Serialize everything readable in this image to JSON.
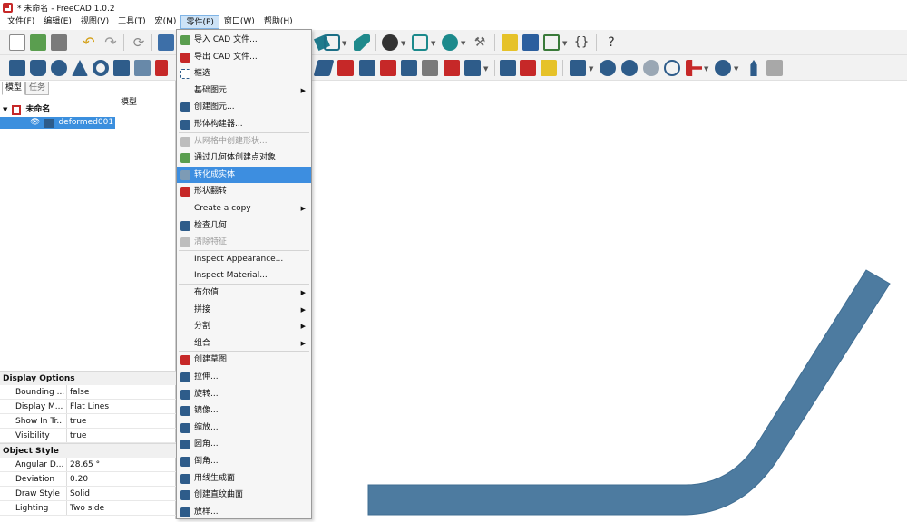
{
  "window": {
    "title": "* 未命名 - FreeCAD 1.0.2"
  },
  "menubar": {
    "items": [
      "文件(F)",
      "编辑(E)",
      "视图(V)",
      "工具(T)",
      "宏(M)",
      "零件(P)",
      "窗口(W)",
      "帮助(H)"
    ],
    "active": "零件(P)"
  },
  "left_panel": {
    "tabs": [
      "模型",
      "任务"
    ],
    "tree_header": "模型",
    "tree": {
      "root": "未命名",
      "child": "deformed001"
    }
  },
  "properties": {
    "groups": [
      {
        "name": "Display Options",
        "rows": [
          {
            "key": "Bounding ...",
            "value": "false"
          },
          {
            "key": "Display M...",
            "value": "Flat Lines"
          },
          {
            "key": "Show In Tr...",
            "value": "true"
          },
          {
            "key": "Visibility",
            "value": "true"
          }
        ]
      },
      {
        "name": "Object Style",
        "rows": [
          {
            "key": "Angular D...",
            "value": "28.65 °"
          },
          {
            "key": "Deviation",
            "value": "0.20"
          },
          {
            "key": "Draw Style",
            "value": "Solid"
          },
          {
            "key": "Lighting",
            "value": "Two side"
          }
        ]
      }
    ]
  },
  "part_menu": {
    "items": [
      {
        "label": "导入 CAD 文件...",
        "icon": "import-icon",
        "enabled": true
      },
      {
        "label": "导出 CAD 文件...",
        "icon": "export-icon",
        "enabled": true
      },
      {
        "label": "框选",
        "icon": "box-select-icon",
        "enabled": true
      },
      {
        "label": "基础图元",
        "submenu": true,
        "enabled": true
      },
      {
        "label": "创建图元...",
        "icon": "primitives-icon",
        "enabled": true
      },
      {
        "label": "形体构建器...",
        "icon": "shape-builder-icon",
        "enabled": true
      },
      {
        "label": "从网格中创建形状...",
        "icon": "mesh-shape-icon",
        "enabled": false
      },
      {
        "label": "通过几何体创建点对象",
        "icon": "points-icon",
        "enabled": true
      },
      {
        "label": "转化成实体",
        "icon": "solid-icon",
        "enabled": true,
        "highlighted": true
      },
      {
        "label": "形状翻转",
        "icon": "reverse-icon",
        "enabled": true
      },
      {
        "label": "Create a copy",
        "submenu": true,
        "enabled": true
      },
      {
        "label": "检查几何",
        "icon": "check-geometry-icon",
        "enabled": true
      },
      {
        "label": "清除特征",
        "icon": "defeaturing-icon",
        "enabled": false
      },
      {
        "label": "Inspect Appearance...",
        "enabled": true
      },
      {
        "label": "Inspect Material...",
        "enabled": true
      },
      {
        "label": "布尔值",
        "submenu": true,
        "enabled": true
      },
      {
        "label": "拼接",
        "submenu": true,
        "enabled": true
      },
      {
        "label": "分割",
        "submenu": true,
        "enabled": true
      },
      {
        "label": "组合",
        "submenu": true,
        "enabled": true
      },
      {
        "label": "创建草图",
        "icon": "sketch-icon",
        "enabled": true
      },
      {
        "label": "拉伸...",
        "icon": "extrude-icon",
        "enabled": true
      },
      {
        "label": "旋转...",
        "icon": "revolve-icon",
        "enabled": true
      },
      {
        "label": "镜像...",
        "icon": "mirror-icon",
        "enabled": true
      },
      {
        "label": "缩放...",
        "icon": "scale-icon",
        "enabled": true
      },
      {
        "label": "圆角...",
        "icon": "fillet-icon",
        "enabled": true
      },
      {
        "label": "倒角...",
        "icon": "chamfer-icon",
        "enabled": true
      },
      {
        "label": "用线生成面",
        "icon": "make-face-icon",
        "enabled": true
      },
      {
        "label": "创建直纹曲面",
        "icon": "ruled-surface-icon",
        "enabled": true
      },
      {
        "label": "放样...",
        "icon": "loft-icon",
        "enabled": true
      }
    ]
  },
  "colors": {
    "shape": "#4d7ba0",
    "highlight": "#3d8ee0",
    "selection": "#3b8fde"
  }
}
